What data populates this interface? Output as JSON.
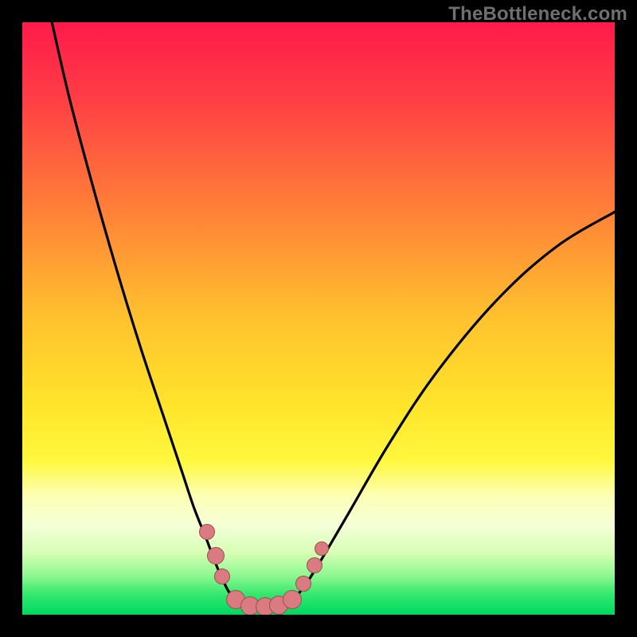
{
  "watermark": "TheBottleneck.com",
  "chart_data": {
    "type": "line",
    "title": "",
    "xlabel": "",
    "ylabel": "",
    "xlim": [
      0,
      100
    ],
    "ylim": [
      0,
      100
    ],
    "grid": false,
    "legend": false,
    "background_gradient_stops": [
      {
        "offset": 0.0,
        "color": "#ff1a4b"
      },
      {
        "offset": 0.12,
        "color": "#ff3b46"
      },
      {
        "offset": 0.3,
        "color": "#ff7a39"
      },
      {
        "offset": 0.5,
        "color": "#ffc22e"
      },
      {
        "offset": 0.65,
        "color": "#ffe52b"
      },
      {
        "offset": 0.74,
        "color": "#fff83e"
      },
      {
        "offset": 0.8,
        "color": "#fdffb5"
      },
      {
        "offset": 0.85,
        "color": "#f4ffd8"
      },
      {
        "offset": 0.895,
        "color": "#d6ffb5"
      },
      {
        "offset": 0.935,
        "color": "#8cf78f"
      },
      {
        "offset": 0.965,
        "color": "#34e86e"
      },
      {
        "offset": 1.0,
        "color": "#00d860"
      }
    ],
    "series": [
      {
        "name": "left-branch",
        "x": [
          5,
          8,
          12,
          16,
          20,
          24,
          27,
          29,
          31,
          32.5,
          34,
          35.5,
          37.5
        ],
        "y": [
          100,
          87,
          72,
          58,
          45,
          33,
          24,
          18,
          13,
          9,
          5.5,
          3,
          1.5
        ]
      },
      {
        "name": "valley-floor",
        "x": [
          37.5,
          39,
          41,
          43,
          44.5
        ],
        "y": [
          1.5,
          1.2,
          1.2,
          1.3,
          1.6
        ]
      },
      {
        "name": "right-branch",
        "x": [
          44.5,
          47,
          50,
          55,
          62,
          70,
          80,
          90,
          100
        ],
        "y": [
          1.6,
          4,
          8.5,
          17,
          29,
          41,
          53,
          62,
          68
        ]
      }
    ],
    "markers": [
      {
        "x": 31.2,
        "y": 14.0,
        "r": 9
      },
      {
        "x": 32.7,
        "y": 10.0,
        "r": 10
      },
      {
        "x": 33.8,
        "y": 6.5,
        "r": 9
      },
      {
        "x": 36.0,
        "y": 2.6,
        "r": 11
      },
      {
        "x": 38.5,
        "y": 1.5,
        "r": 11
      },
      {
        "x": 41.0,
        "y": 1.4,
        "r": 11
      },
      {
        "x": 43.3,
        "y": 1.6,
        "r": 11
      },
      {
        "x": 45.6,
        "y": 2.6,
        "r": 11
      },
      {
        "x": 47.5,
        "y": 5.2,
        "r": 9
      },
      {
        "x": 49.3,
        "y": 8.4,
        "r": 9
      },
      {
        "x": 50.6,
        "y": 11.2,
        "r": 8
      }
    ]
  }
}
